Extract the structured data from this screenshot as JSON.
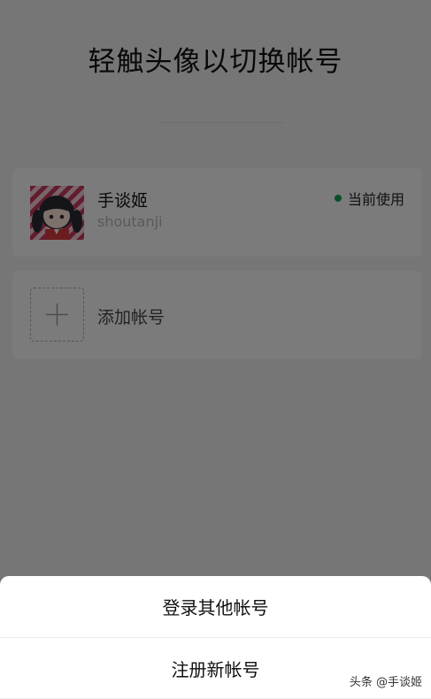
{
  "page": {
    "title": "轻触头像以切换帐号"
  },
  "accounts": [
    {
      "name": "手谈姬",
      "id": "shoutanji",
      "status": "当前使用",
      "status_color": "#12a150"
    }
  ],
  "add_account": {
    "label": "添加帐号",
    "icon": "plus-icon"
  },
  "action_sheet": {
    "login_other_label": "登录其他帐号",
    "register_label": "注册新帐号"
  },
  "watermark": {
    "text": "头条 @手谈姬"
  },
  "colors": {
    "background": "#ededed",
    "card": "#f7f7f7",
    "status_dot": "#12a150"
  }
}
